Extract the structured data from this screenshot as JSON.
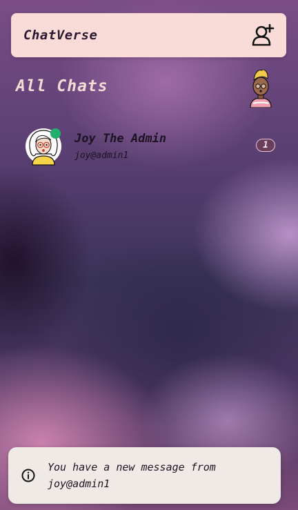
{
  "header": {
    "app_title": "ChatVerse",
    "add_user_icon": "add-user-icon"
  },
  "chat_list": {
    "title": "All Chats",
    "profile_avatar_icon": "user-avatar",
    "items": [
      {
        "name": "Joy The Admin",
        "handle": "joy@admin1",
        "unread_count": "1",
        "online": true,
        "avatar_icon": "user-avatar"
      }
    ]
  },
  "toast": {
    "icon": "info-icon",
    "message": "You have a new message from joy@admin1"
  },
  "colors": {
    "header_bg": "#f9dcd7",
    "online": "#1fae6e",
    "badge_bg": "#6b3e5c",
    "toast_bg": "#f0eae7"
  }
}
